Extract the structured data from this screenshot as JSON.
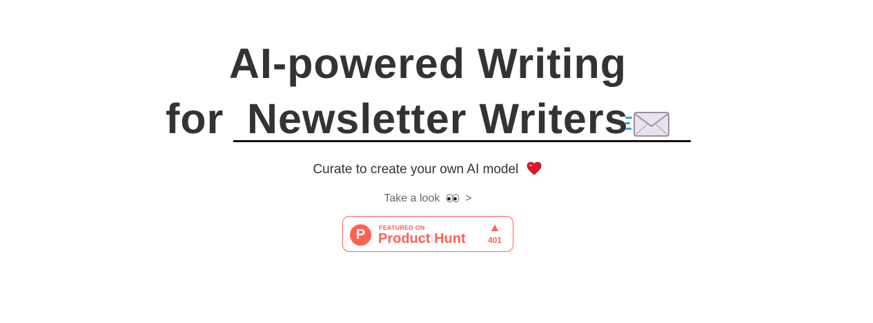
{
  "hero": {
    "headline_line1": "AI-powered Writing",
    "headline_prefix": "for",
    "rotating_word": "Newsletter Writers",
    "subtitle": "Curate to create your own AI model",
    "cta_text": "Take a look",
    "cta_arrow": ">"
  },
  "badge": {
    "featured_label": "FEATURED ON",
    "name": "Product Hunt",
    "logo_letter": "P",
    "upvotes": "401"
  },
  "colors": {
    "text": "#333333",
    "muted": "#666666",
    "product_hunt": "#ff6154",
    "underline": "#111111"
  },
  "icons": [
    "envelope-icon",
    "heart-icon",
    "eyes-icon",
    "product-hunt-logo",
    "upvote-triangle-icon"
  ]
}
